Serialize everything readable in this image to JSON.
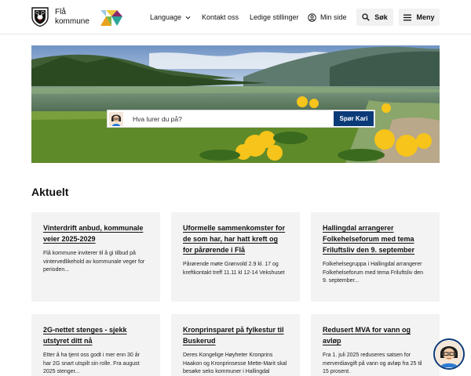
{
  "header": {
    "logo_name_line1": "Flå",
    "logo_name_line2": "kommune",
    "nav": {
      "language": "Language",
      "kontakt": "Kontakt oss",
      "ledige": "Ledige stillinger",
      "min_side": "Min side"
    },
    "search_button": "Søk",
    "menu_button": "Meny"
  },
  "hero": {
    "search_placeholder": "Hva lurer du på?",
    "ask_button": "Spør Kari"
  },
  "section": {
    "title": "Aktuelt",
    "cards": [
      {
        "title": "Vinterdrift anbud, kommunale veier 2025-2029",
        "desc": "Flå kommune inviterer til å gi tilbud på vintervedlikehold av kommunale veger for perioden..."
      },
      {
        "title": "Uformelle sammenkomster for de som har, har hatt kreft og for pårørende i Flå",
        "desc": "Pårørende møte Grønvold 2.9 kl. 17 og kreftkontakt treff 11.11 kl 12-14 Vekshuset"
      },
      {
        "title": "Hallingdal arrangerer Folkehelseforum med tema Friluftsliv den 9. september",
        "desc": "Folkehelsegruppa i Hallingdal arrangerer Folkehelseforum med tema Friluftsliv den 9. september..."
      },
      {
        "title": "2G-nettet stenges - sjekk utstyret ditt nå",
        "desc": "Etter å ha tjent oss godt i mer enn 30 år har 2G snart utspilt sin rolle. Fra august 2025 stenger..."
      },
      {
        "title": "Kronprinsparet på fylkestur til Buskerud",
        "desc": "Deres Kongelige Høyheter Kronprins Haakon og Kronprinsesse Mette-Marit skal besøke seks kommuner i Hallingdal"
      },
      {
        "title": "Redusert MVA for vann og avløp",
        "desc": "Fra 1. juli 2025 reduseres satsen for merverdiavgift på vann og avløp fra 25 til 15 prosent."
      }
    ]
  },
  "colors": {
    "primary": "#0b3a78",
    "card_bg": "#f3f3f3",
    "button_bg": "#f1f1f1"
  },
  "icons": {
    "logo": "bear-crest-icon",
    "brand": "triangles-logo-icon",
    "language": "chevron-down-icon",
    "min_side": "user-circle-icon",
    "search": "search-icon",
    "menu": "hamburger-icon",
    "avatar": "kari-avatar-icon",
    "chat": "chat-avatar-icon"
  }
}
